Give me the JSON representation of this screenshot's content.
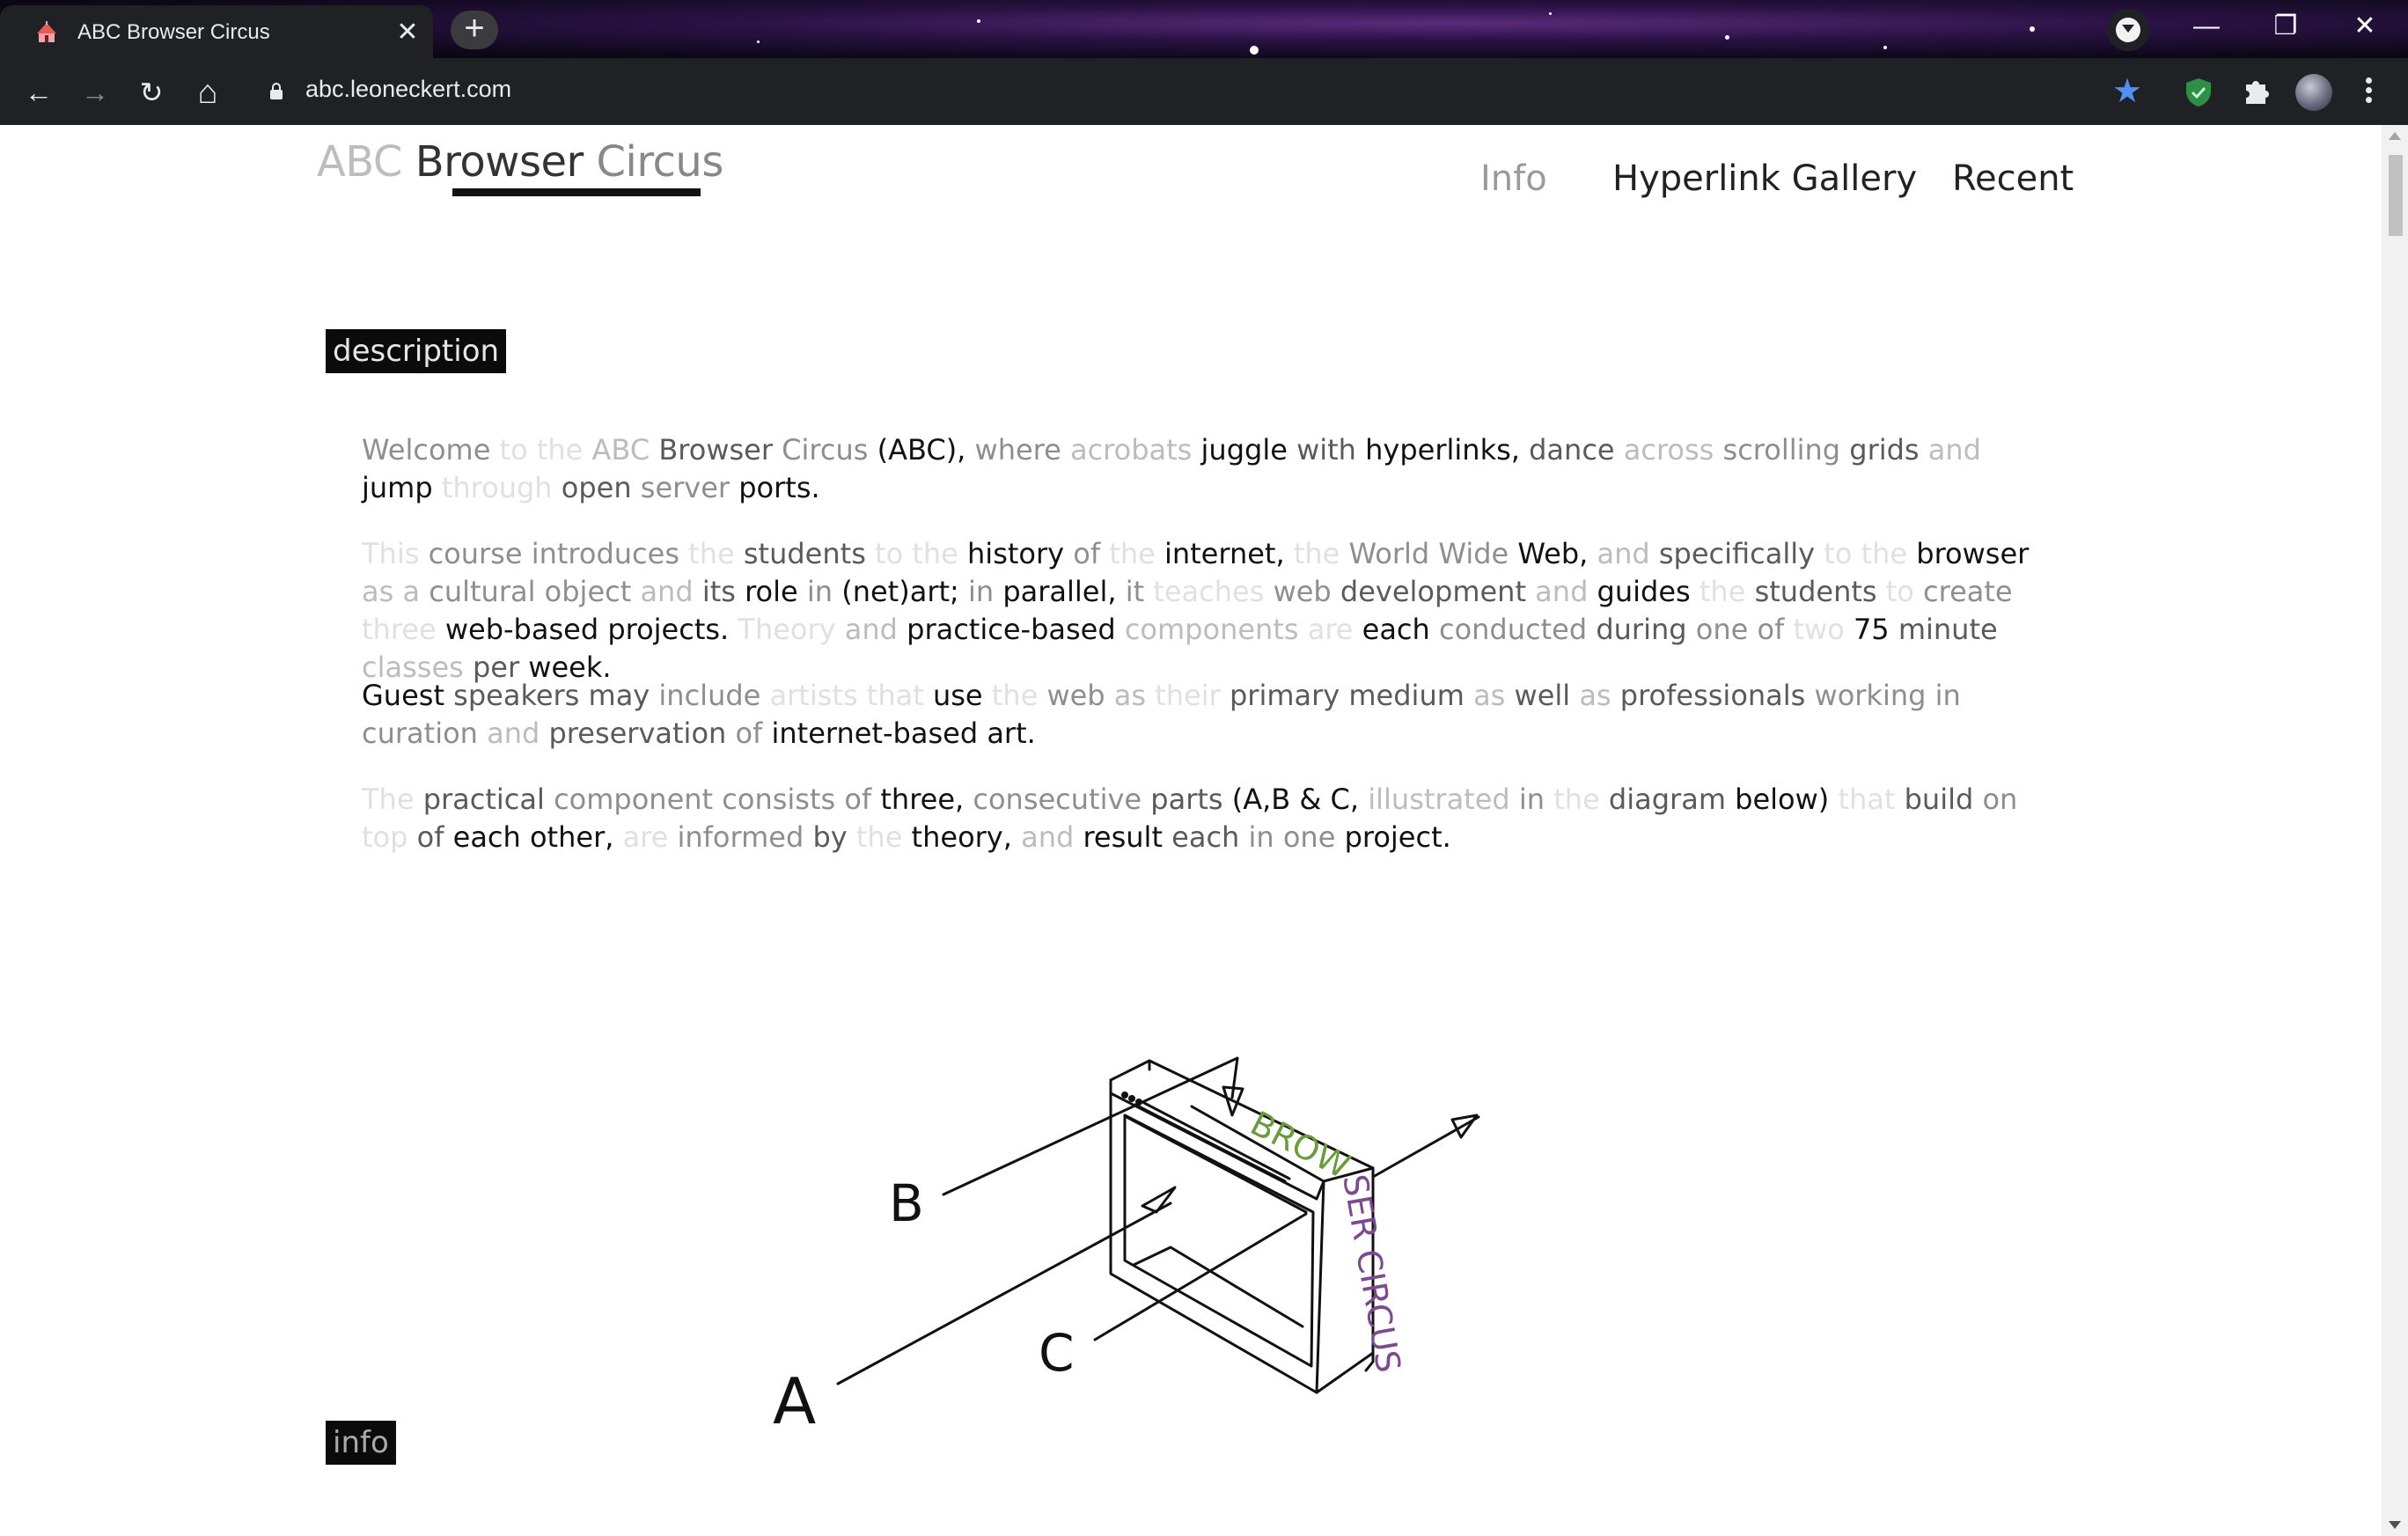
{
  "browser": {
    "tab_title": "ABC Browser Circus",
    "close_glyph": "✕",
    "new_tab_glyph": "+",
    "url": "abc.leoneckert.com",
    "bookmark_glyph": "★",
    "window": {
      "minimize": "—",
      "restore": "❐",
      "close": "✕"
    },
    "nav": {
      "back": "←",
      "forward": "→",
      "reload": "↻",
      "home": "⌂"
    }
  },
  "site": {
    "logo": {
      "part1": "ABC ",
      "part2": "Browser ",
      "part3": "Circus"
    },
    "nav": [
      "Info",
      "Hyperlink Gallery",
      "Recent"
    ]
  },
  "sections": {
    "description_label": "description",
    "info_label": "info"
  },
  "diagram": {
    "labels": {
      "a": "A",
      "b": "B",
      "c": "C"
    },
    "side_text_1": "BROW",
    "side_text_2": "SER CIRCUS"
  },
  "paragraphs": [
    [
      [
        "Welcome",
        2
      ],
      [
        " to",
        0
      ],
      [
        " the",
        0
      ],
      [
        " ABC",
        1
      ],
      [
        " Browser",
        3
      ],
      [
        " Circus",
        2
      ],
      [
        " (ABC),",
        4
      ],
      [
        " where",
        2
      ],
      [
        " acrobats",
        1
      ],
      [
        " juggle",
        4
      ],
      [
        " with",
        3
      ],
      [
        " hyperlinks,",
        4
      ],
      [
        " dance",
        3
      ],
      [
        " across",
        1
      ],
      [
        " scrolling",
        2
      ],
      [
        " grids",
        3
      ],
      [
        " and",
        1
      ],
      [
        " jump",
        4
      ],
      [
        " through",
        0
      ],
      [
        " open",
        3
      ],
      [
        " server",
        2
      ],
      [
        " ports.",
        4
      ]
    ],
    [
      [
        "This",
        0
      ],
      [
        " course",
        2
      ],
      [
        " introduces",
        2
      ],
      [
        " the",
        0
      ],
      [
        " students",
        3
      ],
      [
        " to",
        0
      ],
      [
        " the",
        0
      ],
      [
        " history",
        4
      ],
      [
        " of",
        2
      ],
      [
        " the",
        0
      ],
      [
        " internet,",
        4
      ],
      [
        " the",
        0
      ],
      [
        " World",
        2
      ],
      [
        " Wide",
        2
      ],
      [
        " Web,",
        4
      ],
      [
        " and",
        1
      ],
      [
        " specifically",
        3
      ],
      [
        " to",
        0
      ],
      [
        " the",
        0
      ],
      [
        " browser",
        4
      ],
      [
        " as",
        1
      ],
      [
        " a",
        1
      ],
      [
        " cultural",
        2
      ],
      [
        " object",
        2
      ],
      [
        " and",
        1
      ],
      [
        " its",
        3
      ],
      [
        " role",
        4
      ],
      [
        " in",
        2
      ],
      [
        " (net)art;",
        4
      ],
      [
        " in",
        2
      ],
      [
        " parallel,",
        4
      ],
      [
        " it",
        2
      ],
      [
        " teaches",
        0
      ],
      [
        " web",
        2
      ],
      [
        " development",
        3
      ],
      [
        " and",
        1
      ],
      [
        " guides",
        4
      ],
      [
        " the",
        0
      ],
      [
        " students",
        3
      ],
      [
        " to",
        0
      ],
      [
        " create",
        2
      ],
      [
        " three",
        0
      ],
      [
        " web-based",
        4
      ],
      [
        " projects.",
        4
      ],
      [
        " Theory",
        0
      ],
      [
        " and",
        1
      ],
      [
        " practice-based",
        4
      ],
      [
        " components",
        1
      ],
      [
        " are",
        0
      ],
      [
        " each",
        4
      ],
      [
        " conducted",
        2
      ],
      [
        " during",
        3
      ],
      [
        " one",
        2
      ],
      [
        " of",
        2
      ],
      [
        " two",
        0
      ],
      [
        " 75",
        4
      ],
      [
        " minute",
        3
      ],
      [
        " classes",
        1
      ],
      [
        " per",
        3
      ],
      [
        " week.",
        4
      ]
    ],
    [
      [
        "Guest",
        4
      ],
      [
        " speakers",
        3
      ],
      [
        " may",
        3
      ],
      [
        " include",
        2
      ],
      [
        " artists",
        0
      ],
      [
        " that",
        0
      ],
      [
        " use",
        4
      ],
      [
        " the",
        0
      ],
      [
        " web",
        2
      ],
      [
        " as",
        1
      ],
      [
        " their",
        0
      ],
      [
        " primary",
        3
      ],
      [
        " medium",
        3
      ],
      [
        " as",
        1
      ],
      [
        " well",
        3
      ],
      [
        " as",
        1
      ],
      [
        " professionals",
        3
      ],
      [
        " working",
        2
      ],
      [
        " in",
        2
      ],
      [
        " curation",
        2
      ],
      [
        " and",
        1
      ],
      [
        " preservation",
        3
      ],
      [
        " of",
        2
      ],
      [
        " internet-based",
        4
      ],
      [
        " art.",
        4
      ]
    ],
    [
      [
        "The",
        0
      ],
      [
        " practical",
        3
      ],
      [
        " component",
        2
      ],
      [
        " consists",
        2
      ],
      [
        " of",
        2
      ],
      [
        " three,",
        4
      ],
      [
        " consecutive",
        2
      ],
      [
        " parts",
        3
      ],
      [
        " (A,B",
        4
      ],
      [
        " &",
        4
      ],
      [
        " C,",
        4
      ],
      [
        " illustrated",
        1
      ],
      [
        " in",
        2
      ],
      [
        " the",
        0
      ],
      [
        " diagram",
        3
      ],
      [
        " below)",
        4
      ],
      [
        " that",
        0
      ],
      [
        " build",
        3
      ],
      [
        " on",
        2
      ],
      [
        " top",
        0
      ],
      [
        " of",
        3
      ],
      [
        " each",
        4
      ],
      [
        " other,",
        4
      ],
      [
        " are",
        0
      ],
      [
        " informed",
        2
      ],
      [
        " by",
        3
      ],
      [
        " the",
        0
      ],
      [
        " theory,",
        4
      ],
      [
        " and",
        1
      ],
      [
        " result",
        4
      ],
      [
        " each",
        3
      ],
      [
        " in",
        2
      ],
      [
        " one",
        2
      ],
      [
        " project.",
        4
      ]
    ]
  ]
}
